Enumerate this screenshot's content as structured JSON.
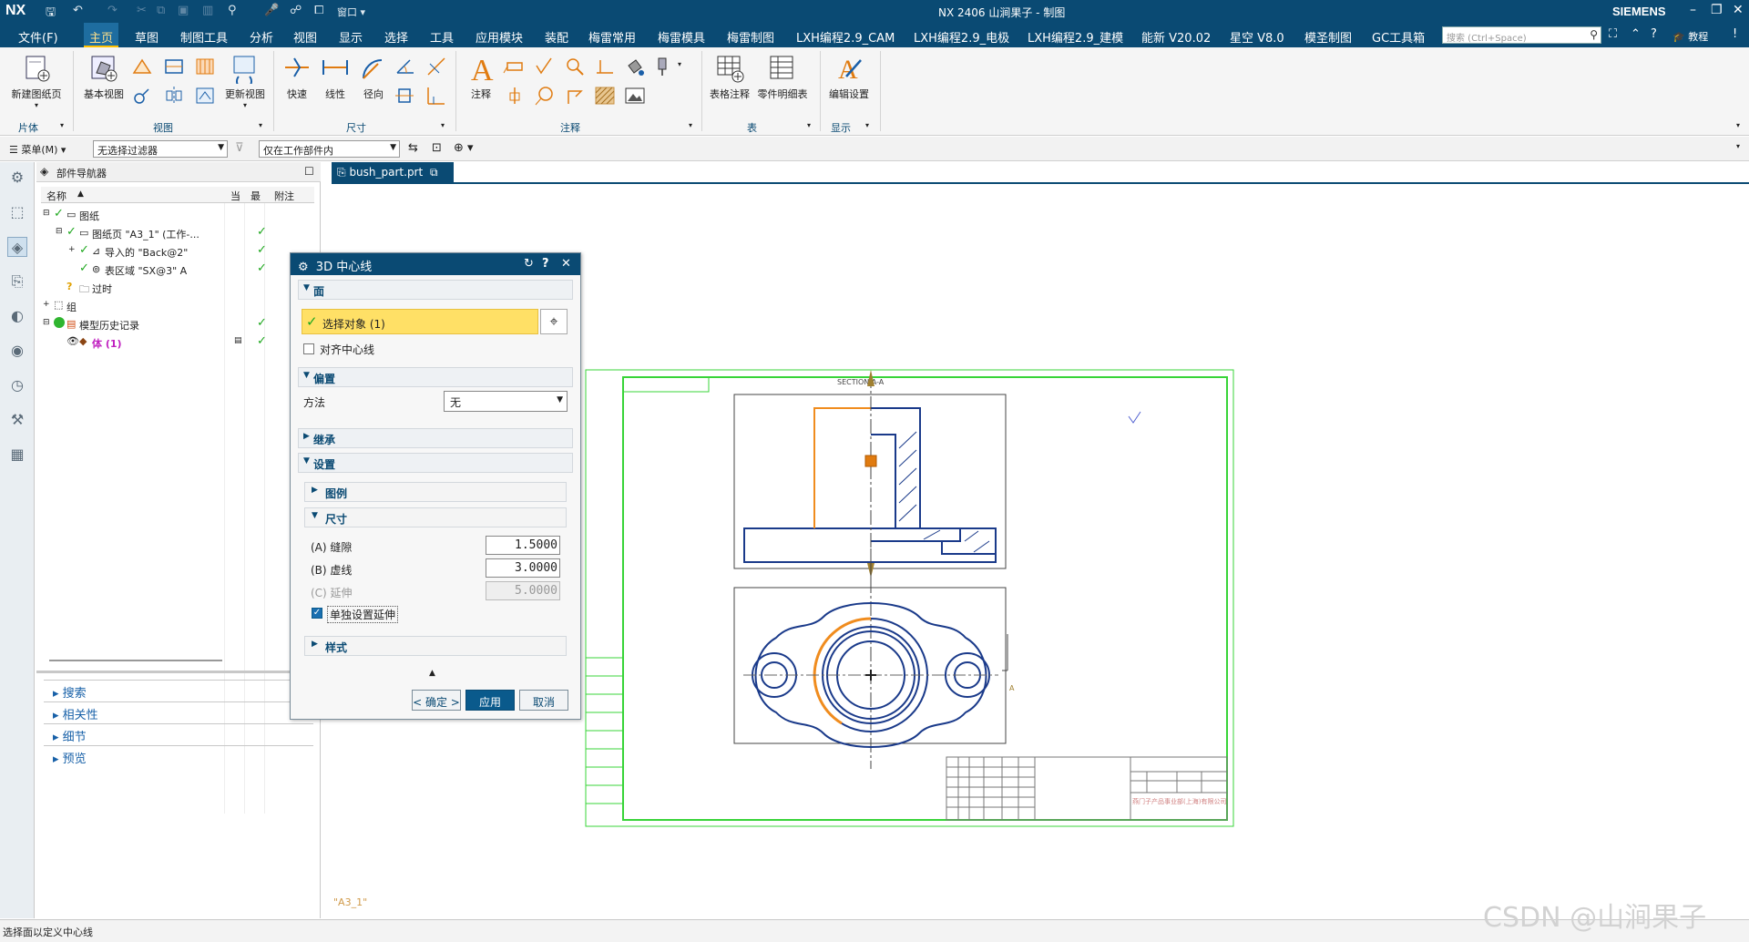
{
  "titlebar": {
    "logo": "NX",
    "window_menu": "窗口",
    "title": "NX 2406 山涧果子 - 制图",
    "brand": "SIEMENS"
  },
  "menubar": {
    "items": [
      "文件(F)",
      "主页",
      "草图",
      "制图工具",
      "分析",
      "视图",
      "显示",
      "选择",
      "工具",
      "应用模块",
      "装配",
      "梅雷常用",
      "梅雷模具",
      "梅雷制图",
      "LXH编程2.9_CAM",
      "LXH编程2.9_电极",
      "LXH编程2.9_建模",
      "能新 V20.02",
      "星空 V8.0",
      "模圣制图",
      "GC工具箱"
    ],
    "active_index": 1,
    "search_placeholder": "搜索 (Ctrl+Space)",
    "tutorial": "教程"
  },
  "ribbon": {
    "buttons": {
      "new_sheet": "新建图纸页",
      "base_view": "基本视图",
      "update_view": "更新视图",
      "quick": "快速",
      "linear": "线性",
      "radial": "径向",
      "note": "注释",
      "table_note": "表格注释",
      "parts_list": "零件明细表",
      "edit_settings": "编辑设置"
    },
    "groups": [
      "片体",
      "视图",
      "尺寸",
      "注释",
      "表",
      "显示"
    ]
  },
  "filterbar": {
    "menu_label": "菜单(M)",
    "filter_value": "无选择过滤器",
    "scope_value": "仅在工作部件内"
  },
  "navigator": {
    "title": "部件导航器",
    "columns": [
      "名称",
      "当",
      "最",
      "附注"
    ],
    "tree": [
      {
        "label": "图纸",
        "indent": 0,
        "checked": true
      },
      {
        "label": "图纸页 \"A3_1\" (工作-...",
        "indent": 1,
        "checked": true
      },
      {
        "label": "导入的 \"Back@2\"",
        "indent": 2,
        "checked": true
      },
      {
        "label": "表区域 \"SX@3\" A",
        "indent": 2,
        "checked": true
      },
      {
        "label": "过时",
        "indent": 1,
        "checked": false
      },
      {
        "label": "组",
        "indent": 0,
        "checked": false
      },
      {
        "label": "模型历史记录",
        "indent": 0,
        "checked": true
      },
      {
        "label": "体 (1)",
        "indent": 1,
        "checked": true
      }
    ],
    "panels": [
      "搜索",
      "相关性",
      "细节",
      "预览"
    ]
  },
  "doc_tab": {
    "label": "bush_part.prt"
  },
  "dialog": {
    "title": "3D 中心线",
    "sections": {
      "face": "面",
      "offset": "偏置",
      "inherit": "继承",
      "settings": "设置"
    },
    "select_object": "选择对象 (1)",
    "align_centerline": "对齐中心线",
    "method_label": "方法",
    "method_value": "无",
    "legend": "图例",
    "dimension": "尺寸",
    "gap_label": "(A) 缝隙",
    "gap_value": "1.5000",
    "dash_label": "(B) 虚线",
    "dash_value": "3.0000",
    "extend_label": "(C) 延伸",
    "extend_value": "5.0000",
    "individual_extend": "单独设置延伸",
    "style": "样式",
    "ok": "< 确定 >",
    "apply": "应用",
    "cancel": "取消"
  },
  "drawing": {
    "section_label": "SECTION  A-A",
    "sheet_label": "\"A3_1\"",
    "company_text": "燕门子产品事业部(上海)有限公司",
    "marker_a": "A"
  },
  "status": {
    "text": "选择面以定义中心线"
  },
  "watermark": "CSDN @山涧果子",
  "colors": {
    "brand": "#0a4a73",
    "highlight": "#ffe066",
    "accent_orange": "#f08c1e",
    "line_blue": "#1a3a8a",
    "border_green": "#38d438"
  }
}
